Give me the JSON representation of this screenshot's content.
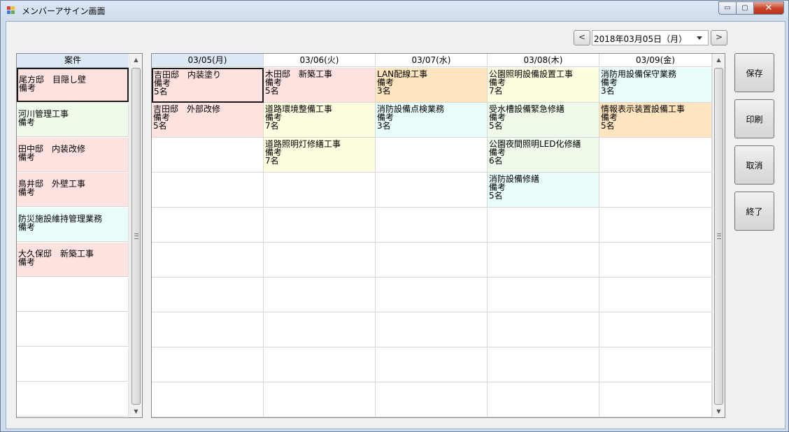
{
  "window": {
    "title": "メンバーアサイン画面",
    "buttons": {
      "minimize": "▭",
      "maximize": "▢",
      "close": "✕"
    }
  },
  "datebar": {
    "prev": "<",
    "next": ">",
    "date": "2018年03月05日（月）"
  },
  "left": {
    "header": "案件",
    "rows": [
      {
        "name": "尾方邸　目隠し壁",
        "note": "備考",
        "color": "#fde2e0"
      },
      {
        "name": "河川管理工事",
        "note": "備考",
        "color": "#eefbea"
      },
      {
        "name": "田中邸　内装改修",
        "note": "備考",
        "color": "#fde2e0"
      },
      {
        "name": "鳥井邸　外壁工事",
        "note": "備考",
        "color": "#fde2e0"
      },
      {
        "name": "防災施設維持管理業務",
        "note": "備考",
        "color": "#eafdfd"
      },
      {
        "name": "大久保邸　新築工事",
        "note": "備考",
        "color": "#fde2e0"
      }
    ]
  },
  "grid": {
    "headers": [
      "03/05(月)",
      "03/06(火)",
      "03/07(水)",
      "03/08(木)",
      "03/09(金)"
    ],
    "columns": [
      [
        {
          "name": "吉田邸　内装塗り",
          "note": "備考",
          "count": "5名",
          "color": "#fde2e0"
        },
        {
          "name": "吉田邸　外部改修",
          "note": "備考",
          "count": "5名",
          "color": "#fde2e0"
        }
      ],
      [
        {
          "name": "木田邸　新築工事",
          "note": "備考",
          "count": "5名",
          "color": "#fde2e0"
        },
        {
          "name": "道路環境整備工事",
          "note": "備考",
          "count": "7名",
          "color": "#fefde0"
        },
        {
          "name": "道路照明灯修繕工事",
          "note": "備考",
          "count": "7名",
          "color": "#fefde0"
        }
      ],
      [
        {
          "name": "LAN配線工事",
          "note": "備考",
          "count": "3名",
          "color": "#fee5bf"
        },
        {
          "name": "消防設備点検業務",
          "note": "備考",
          "count": "3名",
          "color": "#eafdfd"
        }
      ],
      [
        {
          "name": "公園照明設備設置工事",
          "note": "備考",
          "count": "7名",
          "color": "#fefde0"
        },
        {
          "name": "受水槽設備緊急修繕",
          "note": "備考",
          "count": "5名",
          "color": "#eefbea"
        },
        {
          "name": "公園夜間照明LED化修繕",
          "note": "備考",
          "count": "6名",
          "color": "#eefbea"
        },
        {
          "name": "消防設備修繕",
          "note": "備考",
          "count": "5名",
          "color": "#eafdfd"
        }
      ],
      [
        {
          "name": "消防用設備保守業務",
          "note": "備考",
          "count": "3名",
          "color": "#eafdfd"
        },
        {
          "name": "情報表示装置設備工事",
          "note": "備考",
          "count": "5名",
          "color": "#fee5bf"
        }
      ]
    ]
  },
  "actions": {
    "save": "保存",
    "print": "印刷",
    "cancel": "取消",
    "exit": "終了"
  }
}
